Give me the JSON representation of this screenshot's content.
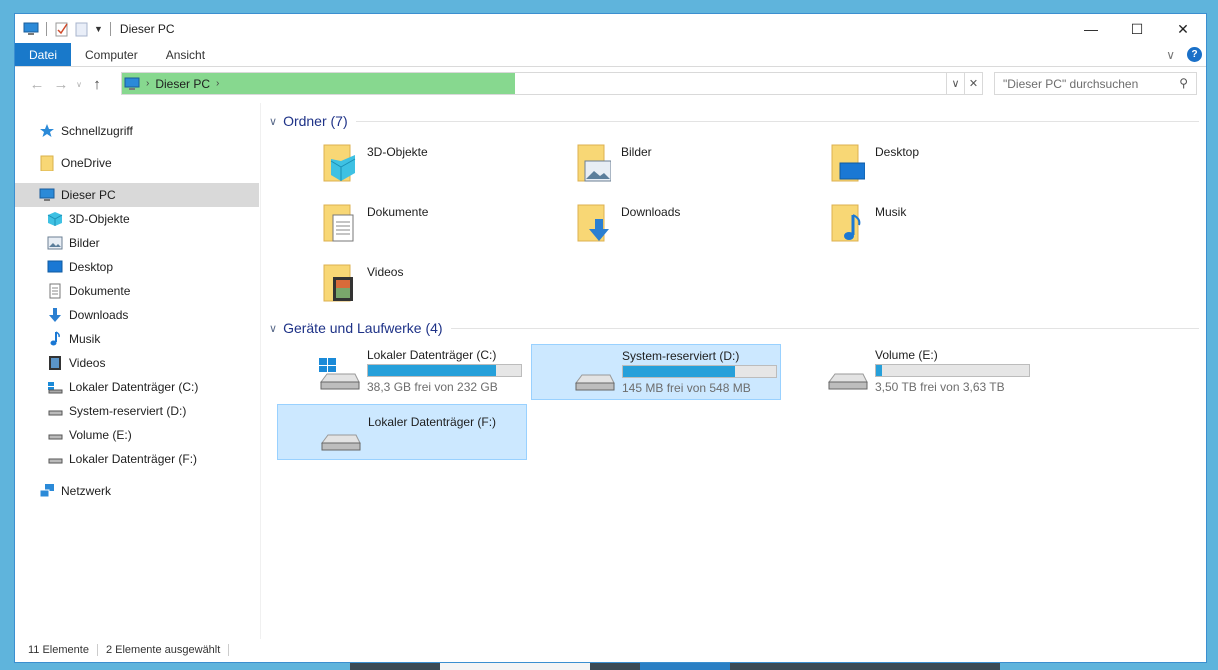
{
  "window": {
    "title": "Dieser PC"
  },
  "ribbon": {
    "tabs": [
      "Datei",
      "Computer",
      "Ansicht"
    ]
  },
  "address": {
    "crumb": "Dieser PC",
    "search_placeholder": "\"Dieser PC\" durchsuchen"
  },
  "nav": {
    "quick": "Schnellzugriff",
    "onedrive": "OneDrive",
    "thispc": "Dieser PC",
    "children": [
      "3D-Objekte",
      "Bilder",
      "Desktop",
      "Dokumente",
      "Downloads",
      "Musik",
      "Videos",
      "Lokaler Datenträger (C:)",
      "System-reserviert (D:)",
      "Volume (E:)",
      "Lokaler Datenträger (F:)"
    ],
    "network": "Netzwerk"
  },
  "content": {
    "folders_header": "Ordner (7)",
    "folders": [
      "3D-Objekte",
      "Bilder",
      "Desktop",
      "Dokumente",
      "Downloads",
      "Musik",
      "Videos"
    ],
    "drives_header": "Geräte und Laufwerke (4)",
    "drives": [
      {
        "name": "Lokaler Datenträger (C:)",
        "free": "38,3 GB frei von 232 GB",
        "used_fraction": 0.835
      },
      {
        "name": "System-reserviert (D:)",
        "free": "145 MB frei von 548 MB",
        "used_fraction": 0.735
      },
      {
        "name": "Volume (E:)",
        "free": "3,50 TB frei von 3,63 TB",
        "used_fraction": 0.036
      },
      {
        "name": "Lokaler Datenträger (F:)",
        "free": "",
        "used_fraction": null
      }
    ]
  },
  "status": {
    "items": "11 Elemente",
    "selected": "2 Elemente ausgewählt"
  },
  "colors": {
    "accent": "#1979ca",
    "selection": "#cce8ff",
    "bar": "#26a0da",
    "address_progress": "#87d88f"
  }
}
